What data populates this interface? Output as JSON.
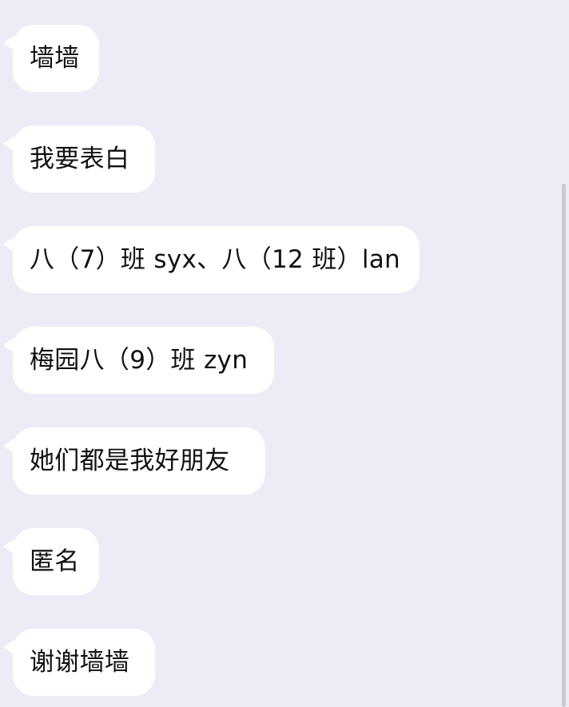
{
  "chat": {
    "messages": [
      {
        "text": "墙墙"
      },
      {
        "text": "我要表白"
      },
      {
        "text": "八（7）班 syx、八（12 班）lan"
      },
      {
        "text": "梅园八（9）班 zyn"
      },
      {
        "text": "她们都是我好朋友"
      },
      {
        "text": "匿名"
      },
      {
        "text": "谢谢墙墙"
      }
    ]
  },
  "colors": {
    "background": "#edecf6",
    "bubble": "#ffffff",
    "text": "#111111",
    "scrollbar": "#c9c9d2"
  }
}
